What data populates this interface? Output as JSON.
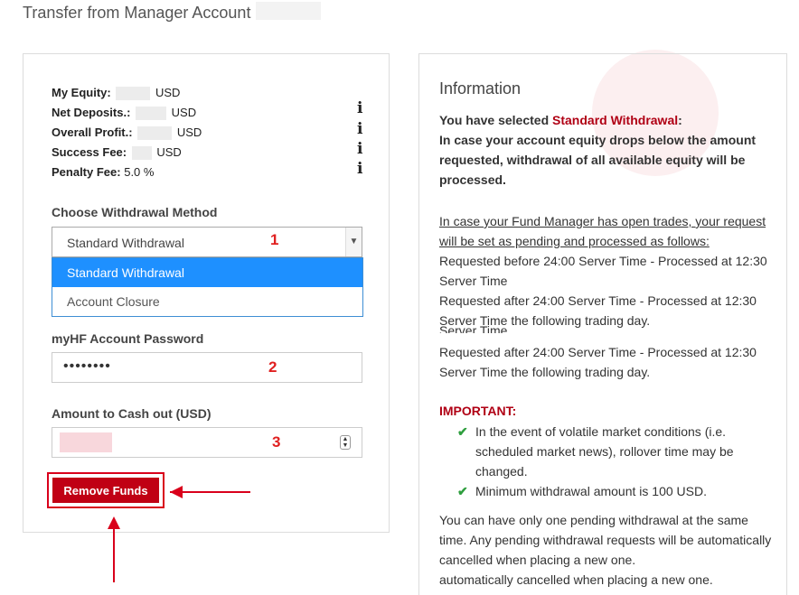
{
  "page_title": "Transfer from Manager Account",
  "account_summary": {
    "equity_label": "My Equity:",
    "equity_unit": "USD",
    "net_deposits_label": "Net Deposits.:",
    "net_deposits_unit": "USD",
    "overall_profit_label": "Overall Profit.:",
    "overall_profit_unit": "USD",
    "success_fee_label": "Success Fee:",
    "success_fee_unit": "USD",
    "penalty_fee_label": "Penalty Fee:",
    "penalty_fee_value": "5.0 %",
    "info_icon_glyph": "i"
  },
  "withdrawal_method": {
    "label": "Choose Withdrawal Method",
    "selected": "Standard Withdrawal",
    "options": [
      "Standard Withdrawal",
      "Account Closure"
    ]
  },
  "password": {
    "label": "myHF Account Password",
    "value_masked": "••••••••"
  },
  "amount": {
    "label": "Amount to Cash out (USD)"
  },
  "step_markers": [
    "1",
    "2",
    "3"
  ],
  "remove_button_label": "Remove Funds",
  "information": {
    "title": "Information",
    "selected_prefix": "You have selected ",
    "selected_method": "Standard Withdrawal",
    "selected_suffix": ":",
    "equity_note": "In case your account equity drops below the amount requested, withdrawal of all available equity will be processed.",
    "open_trades_note": "In case your Fund Manager has open trades, your request will be set as pending and processed as follows:",
    "rule_before": "Requested before 24:00 Server Time - Processed at 12:30 Server Time",
    "rule_after_1": "Requested after 24:00 Server Time - Processed at 12:30 Server Time the following trading day.",
    "rule_after_overlap": "Server Time",
    "rule_after_2": "Requested after 24:00 Server Time - Processed at 12:30 Server Time the following trading day.",
    "important_label": "IMPORTANT:",
    "important_items": [
      "In the event of volatile market conditions (i.e. scheduled market news), rollover time may be changed.",
      "Minimum withdrawal amount is 100 USD."
    ],
    "pending_note": "You can have only one pending withdrawal at the same time. Any pending withdrawal requests will be automatically cancelled when placing a new one.",
    "pending_note_repeat": "automatically cancelled when placing a new one."
  },
  "colors": {
    "accent_red": "#c00014",
    "selected_blue": "#1e90ff",
    "check_green": "#2e9e3e"
  }
}
